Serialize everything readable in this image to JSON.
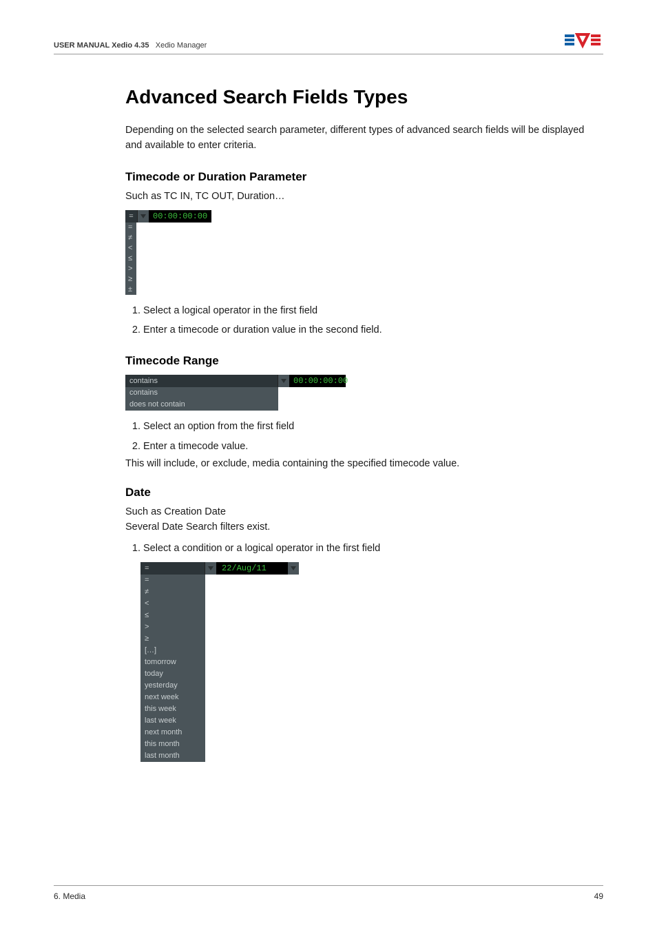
{
  "header": {
    "line": "USER MANUAL Xedio 4.35  Xedio Manager",
    "bold_part": "USER MANUAL Xedio 4.35"
  },
  "logo": {
    "name": "evs-logo"
  },
  "title": "Advanced Search Fields Types",
  "intro": "Depending on the selected search parameter, different types of advanced search fields will be displayed and available to enter criteria.",
  "sections": {
    "timecode": {
      "heading": "Timecode or Duration Parameter",
      "lead": "Such as TC IN, TC OUT, Duration…",
      "dropdown": {
        "selected": "=",
        "value": "00:00:00:00",
        "options": [
          "=",
          "≠",
          "<",
          "≤",
          ">",
          "≥",
          "±"
        ]
      },
      "steps": [
        "Select a logical operator in the first field",
        "Enter a timecode or duration value in the second field."
      ]
    },
    "range": {
      "heading": "Timecode Range",
      "dropdown": {
        "selected": "contains",
        "value": "00:00:00:00",
        "options": [
          "contains",
          "does not contain"
        ]
      },
      "steps": [
        "Select an option from the first field",
        "Enter a timecode value."
      ],
      "note": "This will include, or exclude, media containing the specified timecode value."
    },
    "date": {
      "heading": "Date",
      "lead1": "Such as Creation Date",
      "lead2": "Several Date Search filters exist.",
      "steps": [
        "Select a condition or a logical operator in the first field"
      ],
      "dropdown": {
        "selected": "=",
        "value": "22/Aug/11",
        "options": [
          "=",
          "≠",
          "<",
          "≤",
          ">",
          "≥",
          "[…]",
          "tomorrow",
          "today",
          "yesterday",
          "next week",
          "this week",
          "last week",
          "next month",
          "this month",
          "last month"
        ]
      }
    }
  },
  "footer": {
    "left": "6. Media",
    "right": "49"
  }
}
